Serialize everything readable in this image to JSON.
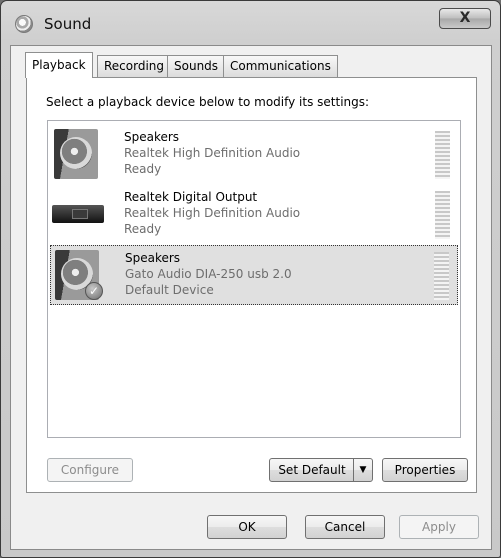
{
  "window": {
    "title": "Sound",
    "close_label": "X"
  },
  "tabs": [
    {
      "label": "Playback"
    },
    {
      "label": "Recording"
    },
    {
      "label": "Sounds"
    },
    {
      "label": "Communications"
    }
  ],
  "instruction": "Select a playback device below to modify its settings:",
  "devices": [
    {
      "name": "Speakers",
      "driver": "Realtek High Definition Audio",
      "status": "Ready"
    },
    {
      "name": "Realtek Digital Output",
      "driver": "Realtek High Definition Audio",
      "status": "Ready"
    },
    {
      "name": "Speakers",
      "driver": "Gato Audio DIA-250 usb 2.0",
      "status": "Default Device"
    }
  ],
  "buttons": {
    "configure": "Configure",
    "set_default": "Set Default",
    "properties": "Properties",
    "ok": "OK",
    "cancel": "Cancel",
    "apply": "Apply"
  },
  "icons": {
    "default_check": "✓",
    "dropdown_arrow": "▼"
  }
}
